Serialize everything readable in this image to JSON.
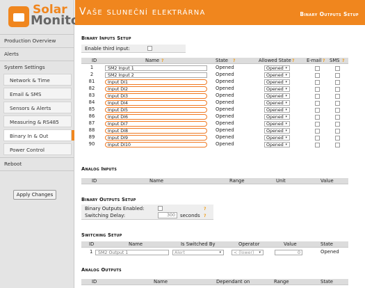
{
  "app": {
    "brand_top": "Solar",
    "brand_bottom": "Monitor",
    "title": "Vaše sluneční elektrárna",
    "section": "Binary Outputs Setup"
  },
  "sidebar": {
    "items": [
      {
        "label": "Production Overview"
      },
      {
        "label": "Alerts"
      },
      {
        "label": "System Settings"
      },
      {
        "label": "Network & Time"
      },
      {
        "label": "Email & SMS"
      },
      {
        "label": "Sensors & Alerts"
      },
      {
        "label": "Measuring & RS485"
      },
      {
        "label": "Binary In & Out"
      },
      {
        "label": "Power Control"
      },
      {
        "label": "Reboot"
      }
    ],
    "apply_label": "Apply Changes"
  },
  "binary_inputs": {
    "heading": "Binary Inputs Setup",
    "enable_third": "Enable third input:",
    "headers": {
      "id": "ID",
      "name": "Name",
      "state": "State",
      "allowed": "Allowed State",
      "email": "E-mail",
      "sms": "SMS"
    },
    "rows": [
      {
        "id": "1",
        "name": "SM2 Input 1",
        "state": "Opened",
        "allowed": "Opened",
        "hl": false
      },
      {
        "id": "2",
        "name": "SM2 Input 2",
        "state": "Opened",
        "allowed": "Opened",
        "hl": false
      },
      {
        "id": "81",
        "name": "Input DI1",
        "state": "Opened",
        "allowed": "Opened",
        "hl": true
      },
      {
        "id": "82",
        "name": "Input DI2",
        "state": "Opened",
        "allowed": "Opened",
        "hl": true
      },
      {
        "id": "83",
        "name": "Input DI3",
        "state": "Opened",
        "allowed": "Opened",
        "hl": true
      },
      {
        "id": "84",
        "name": "Input DI4",
        "state": "Opened",
        "allowed": "Opened",
        "hl": true
      },
      {
        "id": "85",
        "name": "Input DI5",
        "state": "Opened",
        "allowed": "Opened",
        "hl": true
      },
      {
        "id": "86",
        "name": "Input DI6",
        "state": "Opened",
        "allowed": "Opened",
        "hl": true
      },
      {
        "id": "87",
        "name": "Input DI7",
        "state": "Opened",
        "allowed": "Opened",
        "hl": true
      },
      {
        "id": "88",
        "name": "Input DI8",
        "state": "Opened",
        "allowed": "Opened",
        "hl": true
      },
      {
        "id": "89",
        "name": "Input DI9",
        "state": "Opened",
        "allowed": "Opened",
        "hl": true
      },
      {
        "id": "90",
        "name": "Input DI10",
        "state": "Opened",
        "allowed": "Opened",
        "hl": true
      }
    ]
  },
  "analog_inputs": {
    "heading": "Analog Inputs",
    "headers": {
      "id": "ID",
      "name": "Name",
      "range": "Range",
      "unit": "Unit",
      "value": "Value"
    }
  },
  "binary_outputs": {
    "heading": "Binary Outputs Setup",
    "enabled_label": "Binary Outputs Enabled:",
    "delay_label": "Switching Delay:",
    "delay_value": "300",
    "delay_unit": "seconds"
  },
  "switching": {
    "heading": "Switching Setup",
    "headers": {
      "id": "ID",
      "name": "Name",
      "switched_by": "Is Switched By",
      "operator": "Operator",
      "value": "Value",
      "state": "State"
    },
    "row": {
      "id": "1",
      "name": "SM2 Output 1",
      "switched_by": "Alert",
      "operator": "< (lower)",
      "value": "0",
      "state": "Opened"
    }
  },
  "analog_outputs": {
    "heading": "Analog Outputs",
    "headers": {
      "id": "ID",
      "name": "Name",
      "dependant": "Dependant on",
      "range": "Range",
      "state": "State"
    }
  },
  "help_glyph": "?",
  "caret_glyph": "▾"
}
